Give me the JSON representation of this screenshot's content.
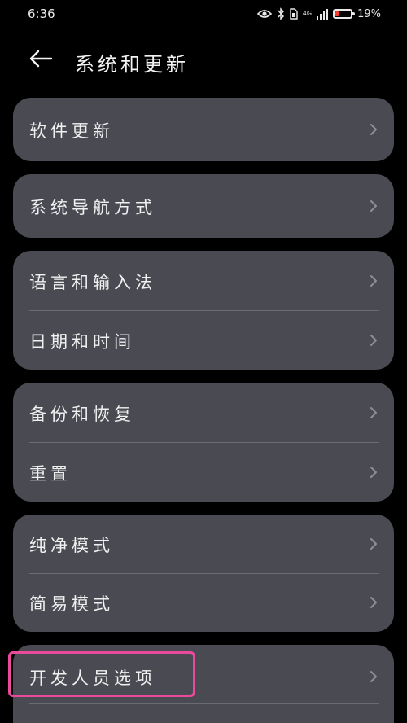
{
  "status_bar": {
    "time": "6:36",
    "network_label": "4G",
    "battery_percent": "19%"
  },
  "header": {
    "title": "系统和更新",
    "back_icon": "arrow-left-icon"
  },
  "groups": [
    {
      "items": [
        {
          "label": "软件更新"
        }
      ]
    },
    {
      "items": [
        {
          "label": "系统导航方式"
        }
      ]
    },
    {
      "items": [
        {
          "label": "语言和输入法"
        },
        {
          "label": "日期和时间"
        }
      ]
    },
    {
      "items": [
        {
          "label": "备份和恢复"
        },
        {
          "label": "重置"
        }
      ]
    },
    {
      "items": [
        {
          "label": "纯净模式"
        },
        {
          "label": "简易模式"
        }
      ]
    },
    {
      "items": [
        {
          "label": "开发人员选项"
        }
      ]
    }
  ],
  "colors": {
    "background": "#000000",
    "card": "#4a4b52",
    "text": "#f0f0f0",
    "chevron": "#8e8f96",
    "highlight": "#e94a9c",
    "battery_low": "#ff3b30"
  }
}
